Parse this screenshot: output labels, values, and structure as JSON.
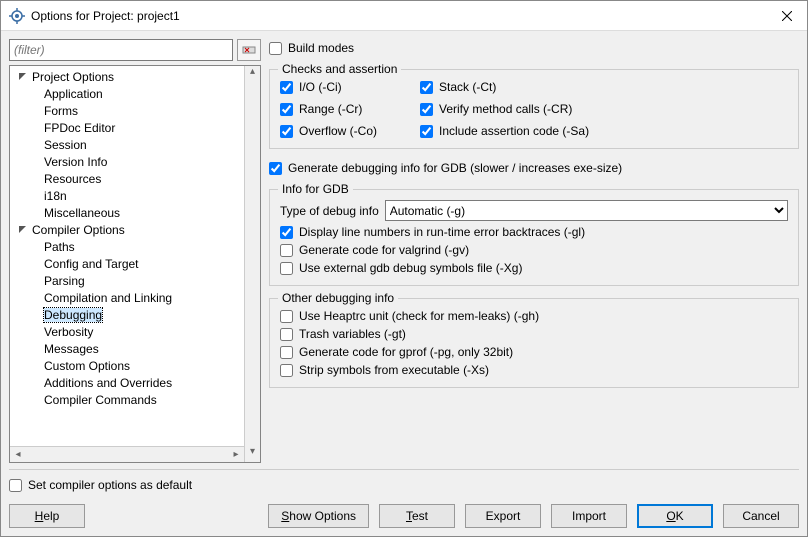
{
  "window": {
    "title": "Options for Project: project1"
  },
  "filter": {
    "placeholder": "(filter)"
  },
  "tree": {
    "groups": [
      {
        "label": "Project Options",
        "items": [
          "Application",
          "Forms",
          "FPDoc Editor",
          "Session",
          "Version Info",
          "Resources",
          "i18n",
          "Miscellaneous"
        ]
      },
      {
        "label": "Compiler Options",
        "items": [
          "Paths",
          "Config and Target",
          "Parsing",
          "Compilation and Linking",
          "Debugging",
          "Verbosity",
          "Messages",
          "Custom Options",
          "Additions and Overrides",
          "Compiler Commands"
        ],
        "selected": "Debugging"
      }
    ]
  },
  "right": {
    "build_modes": "Build modes",
    "checks_group_title": "Checks and assertion",
    "checks": {
      "io": "I/O (-Ci)",
      "range": "Range (-Cr)",
      "overflow": "Overflow (-Co)",
      "stack": "Stack (-Ct)",
      "verify": "Verify method calls (-CR)",
      "assert": "Include assertion code (-Sa)"
    },
    "gen_debug": "Generate debugging info for GDB (slower / increases exe-size)",
    "gdb_group_title": "Info for GDB",
    "debug_type_label": "Type of debug info",
    "debug_type_value": "Automatic (-g)",
    "line_numbers": "Display line numbers in run-time error backtraces (-gl)",
    "valgrind": "Generate code for valgrind (-gv)",
    "ext_gdb": "Use external gdb debug symbols file (-Xg)",
    "other_group_title": "Other debugging info",
    "heaptrc": "Use Heaptrc unit (check for mem-leaks) (-gh)",
    "trash": "Trash variables (-gt)",
    "gprof": "Generate code for gprof (-pg, only 32bit)",
    "strip": "Strip symbols from executable (-Xs)"
  },
  "bottom": {
    "set_default": "Set compiler options as default"
  },
  "buttons": {
    "help": "Help",
    "show_options": "Show Options",
    "test": "Test",
    "export": "Export",
    "import": "Import",
    "ok": "OK",
    "cancel": "Cancel"
  }
}
